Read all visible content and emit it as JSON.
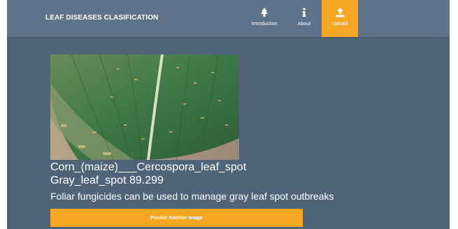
{
  "navbar": {
    "brand": "LEAF DISEASES CLASIFICATION",
    "items": [
      {
        "label": "Introduction",
        "icon": "tree-icon",
        "active": false
      },
      {
        "label": "About",
        "icon": "info-icon",
        "active": false
      },
      {
        "label": "Upload",
        "icon": "upload-icon",
        "active": true
      }
    ]
  },
  "result": {
    "disease_class": "Corn_(maize)___Cercospora_leaf_spot",
    "disease_score": "Gray_leaf_spot 89.299",
    "advice": "Foliar fungicides can be used to manage gray leaf spot outbreaks"
  },
  "actions": {
    "predict_again_label": "Predict Another Image"
  },
  "colors": {
    "accent": "#f5a623",
    "navbar": "#5e7389",
    "background": "#506479"
  }
}
